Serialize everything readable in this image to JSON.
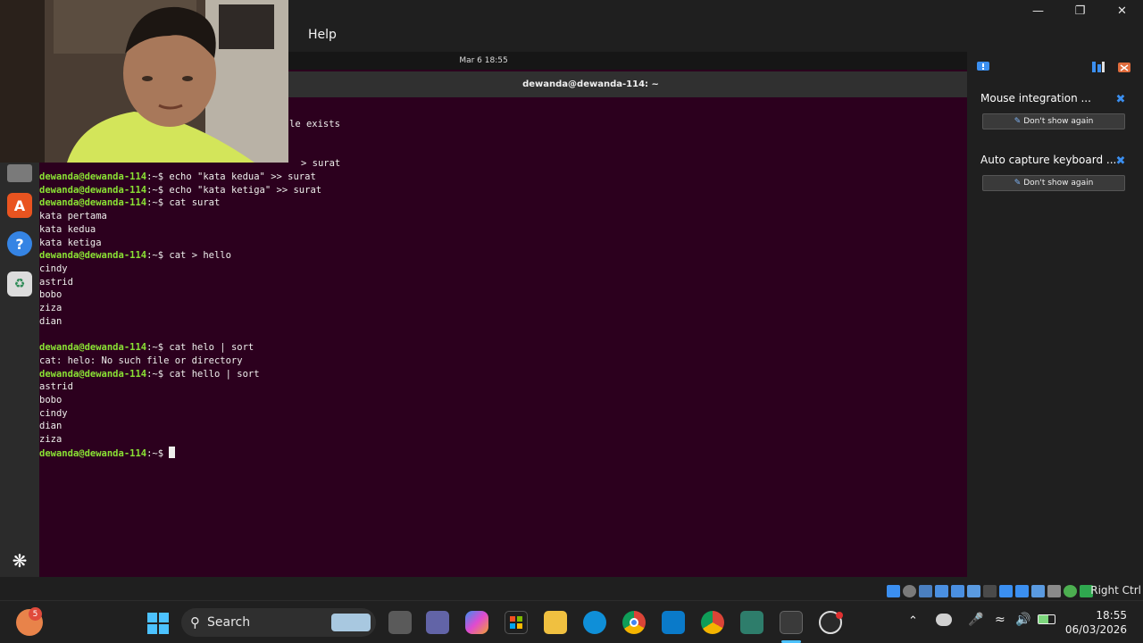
{
  "host": {
    "menu_help": "Help",
    "right_ctrl": "Right Ctrl"
  },
  "guest": {
    "topbar_datetime": "Mar 6  18:55",
    "terminal_title": "dewanda@dewanda-114: ~"
  },
  "terminal": {
    "prompt": "dewanda@dewanda-114",
    "prompt_suffix": ":~",
    "lines": [
      {
        "type": "out",
        "text": "le exists",
        "partial": true
      },
      {
        "type": "out",
        "text": "> surat",
        "partial": true
      },
      {
        "type": "cmd",
        "text": "echo \"kata kedua\" >> surat"
      },
      {
        "type": "cmd",
        "text": "echo \"kata ketiga\" >> surat"
      },
      {
        "type": "cmd",
        "text": "cat surat"
      },
      {
        "type": "out",
        "text": "kata pertama"
      },
      {
        "type": "out",
        "text": "kata kedua"
      },
      {
        "type": "out",
        "text": "kata ketiga"
      },
      {
        "type": "cmd",
        "text": "cat > hello"
      },
      {
        "type": "out",
        "text": "cindy"
      },
      {
        "type": "out",
        "text": "astrid"
      },
      {
        "type": "out",
        "text": "bobo"
      },
      {
        "type": "out",
        "text": "ziza"
      },
      {
        "type": "out",
        "text": "dian"
      },
      {
        "type": "out",
        "text": ""
      },
      {
        "type": "cmd",
        "text": "cat helo | sort"
      },
      {
        "type": "out",
        "text": "cat: helo: No such file or directory"
      },
      {
        "type": "cmd",
        "text": "cat hello | sort"
      },
      {
        "type": "out",
        "text": "astrid"
      },
      {
        "type": "out",
        "text": "bobo"
      },
      {
        "type": "out",
        "text": "cindy"
      },
      {
        "type": "out",
        "text": "dian"
      },
      {
        "type": "out",
        "text": "ziza"
      },
      {
        "type": "cmd",
        "text": "",
        "cursor": true
      }
    ]
  },
  "notifications": [
    {
      "title": "Mouse integration ...",
      "button": "Don't show again"
    },
    {
      "title": "Auto capture keyboard ...",
      "button": "Don't show again"
    }
  ],
  "taskbar": {
    "search_label": "Search",
    "notification_badge": "5",
    "clock_time": "18:55",
    "clock_date": "06/03/2026",
    "colors": {
      "accent": "#3b8ff0",
      "bg": "#202020"
    }
  },
  "dock_icons": [
    "files-icon",
    "app-center-icon",
    "help-icon",
    "trash-icon",
    "show-apps-icon"
  ]
}
